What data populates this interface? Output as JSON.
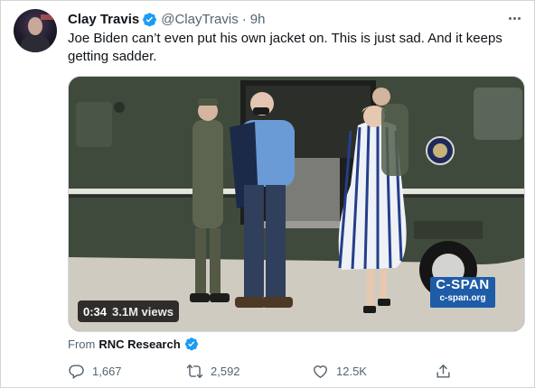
{
  "author": {
    "name": "Clay Travis",
    "handle": "@ClayTravis",
    "separator": "·",
    "time": "9h",
    "verified": true
  },
  "tweet_text": "Joe Biden can’t even put his own jacket on. This is just sad. And it keeps getting sadder.",
  "media": {
    "type": "video",
    "duration": "0:34",
    "views": "3.1M views",
    "watermark_line1": "C-SPAN",
    "watermark_line2": "c-span.org"
  },
  "attribution": {
    "label": "From",
    "source": "RNC Research",
    "verified": true
  },
  "actions": {
    "reply_count": "1,667",
    "retweet_count": "2,592",
    "like_count": "12.5K"
  },
  "icons": {
    "verified": "verified-badge-icon",
    "more": "more-icon",
    "reply": "reply-icon",
    "retweet": "retweet-icon",
    "like": "heart-icon",
    "share": "share-icon"
  },
  "colors": {
    "accent": "#1d9bf0",
    "text_primary": "#0f1419",
    "text_secondary": "#536471",
    "cspan": "#1e5ca8"
  }
}
